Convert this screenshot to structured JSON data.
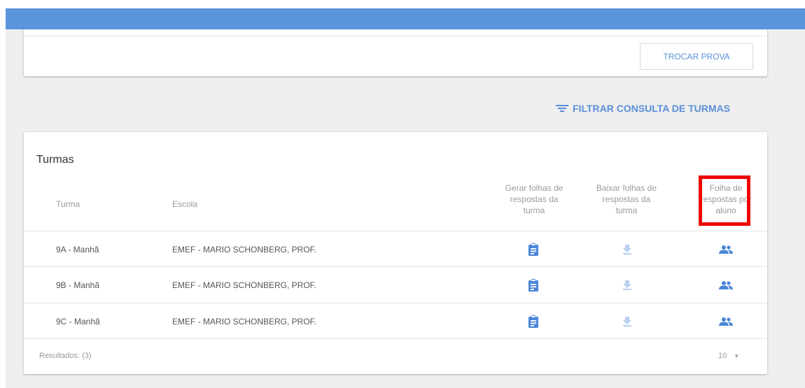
{
  "header": {
    "bar_color": "#5b95db"
  },
  "top_card": {
    "change_test_button": "TROCAR PROVA"
  },
  "filter": {
    "label": "FILTRAR CONSULTA DE TURMAS",
    "icon": "filter-list-icon"
  },
  "table": {
    "title": "Turmas",
    "columns": {
      "turma": "Turma",
      "escola": "Escola",
      "gerar": [
        "Gerar folhas de",
        "respostas da",
        "turma"
      ],
      "baixar": [
        "Baixar folhas de",
        "respostas da",
        "turma"
      ],
      "folha_aluno": [
        "Folha de",
        "respostas por",
        "aluno"
      ]
    },
    "rows": [
      {
        "turma": "9A - Manhã",
        "escola": "EMEF - MARIO SCHONBERG, PROF."
      },
      {
        "turma": "9B - Manhã",
        "escola": "EMEF - MARIO SCHONBERG, PROF."
      },
      {
        "turma": "9C - Manhã",
        "escola": "EMEF - MARIO SCHONBERG, PROF."
      }
    ],
    "icons": {
      "generate": "clipboard-icon",
      "download": "download-icon",
      "students": "people-icon"
    },
    "footer": {
      "results": "Resultados: (3)",
      "page_size": "10"
    }
  },
  "colors": {
    "accent": "#5b8fd9",
    "icon_blue": "#4a86d8",
    "icon_disabled": "#b9d0ee",
    "highlight": "#ee0000"
  }
}
